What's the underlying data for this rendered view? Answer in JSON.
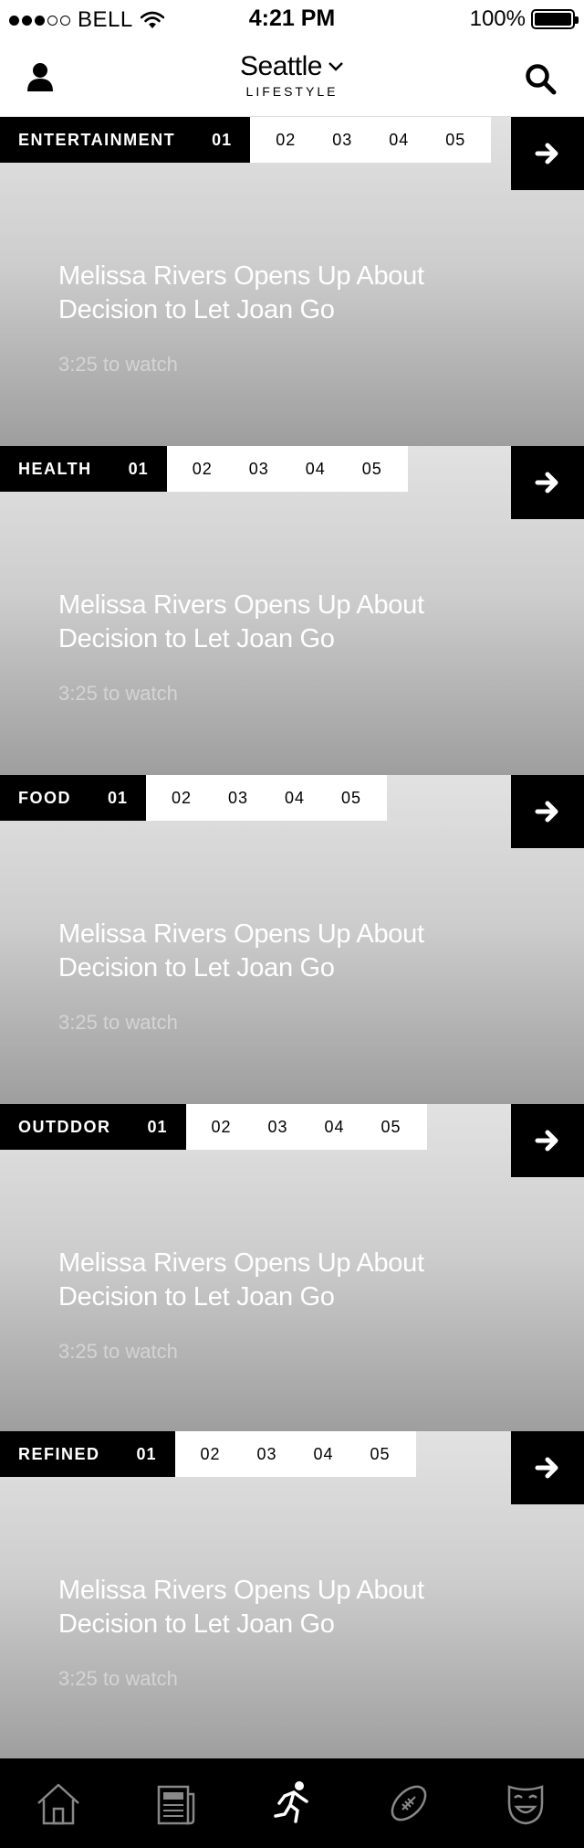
{
  "status_bar": {
    "carrier": "BELL",
    "time": "4:21 PM",
    "battery": "100%",
    "signal_filled": 3,
    "signal_total": 5
  },
  "header": {
    "city": "Seattle",
    "subtitle": "LIFESTYLE",
    "left_icon": "profile-icon",
    "right_icon": "search-icon"
  },
  "sections": [
    {
      "category": "ENTERTAINMENT",
      "active_page": "01",
      "pages": [
        "02",
        "03",
        "04",
        "05"
      ],
      "headline": "Melissa Rivers Opens Up About Decision to Let Joan Go",
      "duration": "3:25 to watch"
    },
    {
      "category": "HEALTH",
      "active_page": "01",
      "pages": [
        "02",
        "03",
        "04",
        "05"
      ],
      "headline": "Melissa Rivers Opens Up About Decision to Let Joan Go",
      "duration": "3:25 to watch"
    },
    {
      "category": "FOOD",
      "active_page": "01",
      "pages": [
        "02",
        "03",
        "04",
        "05"
      ],
      "headline": "Melissa Rivers Opens Up About Decision to Let Joan Go",
      "duration": "3:25 to watch"
    },
    {
      "category": "OUTDDOR",
      "active_page": "01",
      "pages": [
        "02",
        "03",
        "04",
        "05"
      ],
      "headline": "Melissa Rivers Opens Up About Decision to Let Joan Go",
      "duration": "3:25 to watch"
    },
    {
      "category": "REFINED",
      "active_page": "01",
      "pages": [
        "02",
        "03",
        "04",
        "05"
      ],
      "headline": "Melissa Rivers Opens Up About Decision to Let Joan Go",
      "duration": "3:25 to watch"
    }
  ],
  "tab_bar": {
    "tabs": [
      "home-icon",
      "news-icon",
      "activity-icon",
      "sports-icon",
      "entertainment-icon"
    ],
    "active": "activity-icon"
  },
  "colors": {
    "bar_background": "#000000",
    "headline_text": "#ffffff",
    "duration_text": "#d4d4d4"
  }
}
